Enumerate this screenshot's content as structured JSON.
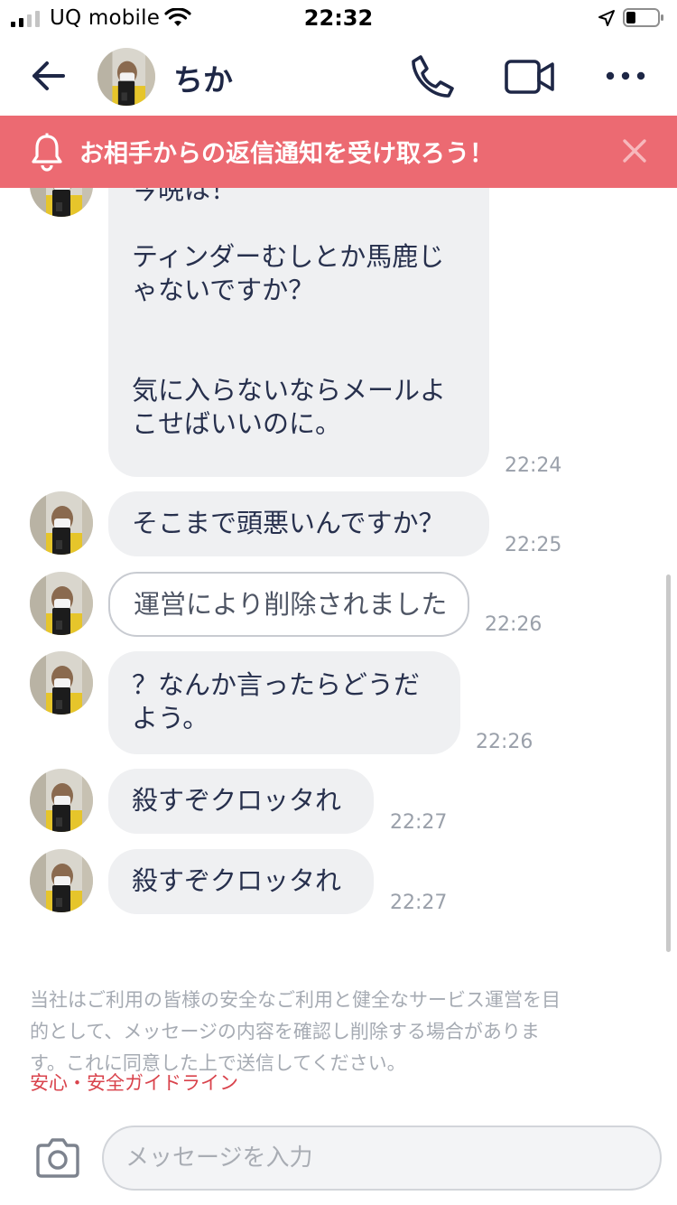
{
  "status_bar": {
    "carrier": "UQ mobile",
    "time": "22:32",
    "signal_icon": "cellular-signal-icon",
    "wifi_icon": "wifi-icon",
    "location_icon": "location-arrow-icon",
    "battery_icon": "battery-icon",
    "battery_level": 0.3
  },
  "header": {
    "contact_name": "ちか",
    "back_icon": "back-arrow-icon",
    "call_icon": "phone-icon",
    "video_icon": "video-camera-icon",
    "more_icon": "more-horizontal-icon"
  },
  "banner": {
    "text": "お相手からの返信通知を受け取ろう！",
    "icon": "bell-icon",
    "close_icon": "close-icon",
    "color": "#ec6a72"
  },
  "messages": [
    {
      "lines": [
        "今晩は！",
        "",
        "ティンダーむしとか馬鹿じ",
        "ゃないですか？",
        "",
        "",
        "気に入らないならメールよ",
        "こせばいいのに。"
      ],
      "time": "22:24",
      "deleted": false
    },
    {
      "lines": [
        "そこまで頭悪いんですか？"
      ],
      "time": "22:25",
      "deleted": false
    },
    {
      "lines": [
        "運営により削除されました"
      ],
      "time": "22:26",
      "deleted": true
    },
    {
      "lines": [
        "？なんか言ったらどうだ",
        "よう。"
      ],
      "time": "22:26",
      "deleted": false
    },
    {
      "lines": [
        "殺すぞクロッタれ"
      ],
      "time": "22:27",
      "deleted": false
    },
    {
      "lines": [
        "殺すぞクロッタれ"
      ],
      "time": "22:27",
      "deleted": false
    }
  ],
  "notice": {
    "lines": [
      "当社はご利用の皆様の安全なご利用と健全なサービス運営を目",
      "的として、メッセージの内容を確認し削除する場合がありま",
      "す。これに同意した上で送信してください。"
    ],
    "link": "安心・安全ガイドライン"
  },
  "composer": {
    "placeholder": "メッセージを入力",
    "camera_icon": "camera-icon"
  }
}
